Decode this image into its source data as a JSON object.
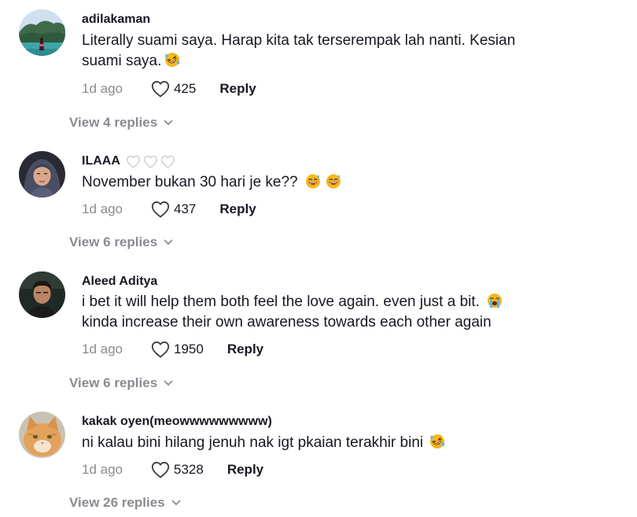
{
  "comments": [
    {
      "username": "adilakaman",
      "text_line1": "Literally suami saya. Harap kita tak terserempak lah nanti. Kesian",
      "text_line2": "suami saya.",
      "emoji": "rofl-emoji",
      "time": "1d ago",
      "likes": "425",
      "reply_label": "Reply",
      "view_replies": "View 4 replies"
    },
    {
      "username": "ILAAA",
      "badges": [
        "heart-outline-icon",
        "heart-outline-icon",
        "heart-outline-icon"
      ],
      "text_line1": "November bukan 30 hari je ke??",
      "emoji": [
        "sweat-smile-emoji",
        "sweat-smile-emoji"
      ],
      "time": "1d ago",
      "likes": "437",
      "reply_label": "Reply",
      "view_replies": "View 6 replies"
    },
    {
      "username": "Aleed Aditya",
      "text_line1": "i bet it will help them both feel the love again. even just a bit.",
      "text_line2": "kinda increase their own awareness towards each other again",
      "emoji": "loudly-crying-emoji",
      "time": "1d ago",
      "likes": "1950",
      "reply_label": "Reply",
      "view_replies": "View 6 replies"
    },
    {
      "username": "kakak oyen(meowwwwwwwww)",
      "text_line1": "ni kalau bini hilang jenuh nak igt pkaian terakhir bini",
      "emoji": "rofl-emoji",
      "time": "1d ago",
      "likes": "5328",
      "reply_label": "Reply",
      "view_replies": "View 26 replies"
    }
  ],
  "colors": {
    "text": "#161823",
    "muted": "#8a8b91",
    "emoji_yellow": "#f7b71d"
  }
}
